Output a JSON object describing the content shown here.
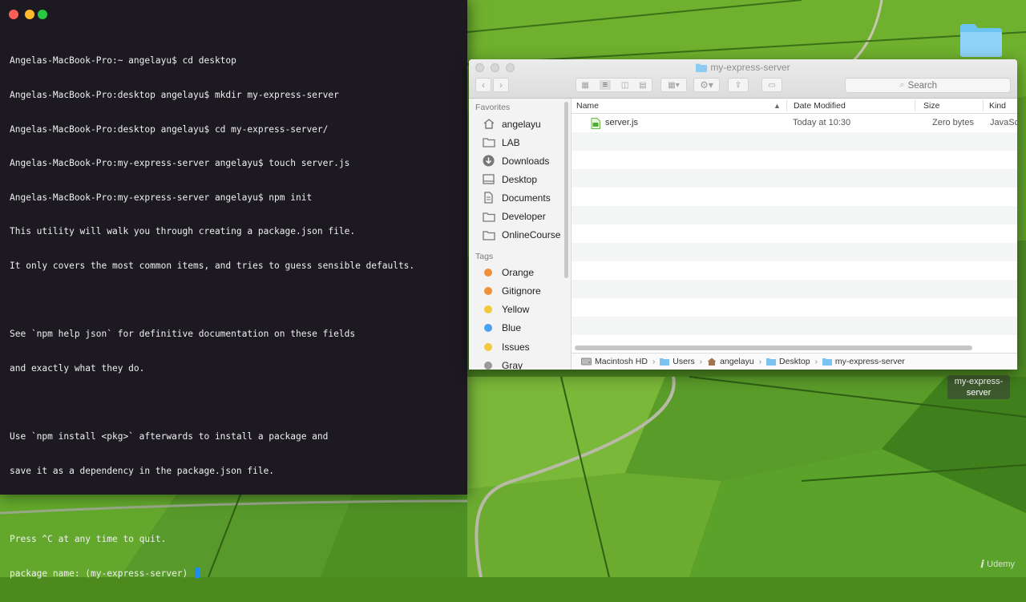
{
  "terminal": {
    "lines": [
      "Angelas-MacBook-Pro:~ angelayu$ cd desktop",
      "Angelas-MacBook-Pro:desktop angelayu$ mkdir my-express-server",
      "Angelas-MacBook-Pro:desktop angelayu$ cd my-express-server/",
      "Angelas-MacBook-Pro:my-express-server angelayu$ touch server.js",
      "Angelas-MacBook-Pro:my-express-server angelayu$ npm init",
      "This utility will walk you through creating a package.json file.",
      "It only covers the most common items, and tries to guess sensible defaults.",
      "",
      "See `npm help json` for definitive documentation on these fields",
      "and exactly what they do.",
      "",
      "Use `npm install <pkg>` afterwards to install a package and",
      "save it as a dependency in the package.json file.",
      "",
      "Press ^C at any time to quit.",
      "package name: (my-express-server) "
    ]
  },
  "finder": {
    "title": "my-express-server",
    "search_placeholder": "Search",
    "sidebar": {
      "favorites_heading": "Favorites",
      "favorites": [
        {
          "label": "angelayu",
          "icon": "home-icon"
        },
        {
          "label": "LAB",
          "icon": "folder-icon"
        },
        {
          "label": "Downloads",
          "icon": "downloads-icon"
        },
        {
          "label": "Desktop",
          "icon": "desktop-icon"
        },
        {
          "label": "Documents",
          "icon": "documents-icon"
        },
        {
          "label": "Developer",
          "icon": "folder-icon"
        },
        {
          "label": "OnlineCourse",
          "icon": "folder-icon"
        }
      ],
      "tags_heading": "Tags",
      "tags": [
        {
          "label": "Orange",
          "color": "#f0913a"
        },
        {
          "label": "Gitignore",
          "color": "#f0913a"
        },
        {
          "label": "Yellow",
          "color": "#f2c83c"
        },
        {
          "label": "Blue",
          "color": "#4aa1f0"
        },
        {
          "label": "Issues",
          "color": "#f2c83c"
        },
        {
          "label": "Gray",
          "color": "#9a9a9a"
        }
      ]
    },
    "columns": {
      "name": "Name",
      "date_modified": "Date Modified",
      "size": "Size",
      "kind": "Kind"
    },
    "files": [
      {
        "name": "server.js",
        "date_modified": "Today at 10:30",
        "size": "Zero bytes",
        "kind": "JavaSc"
      }
    ],
    "path": [
      "Macintosh HD",
      "Users",
      "angelayu",
      "Desktop",
      "my-express-server"
    ]
  },
  "desktop": {
    "folder_label": "my-express-server",
    "watermark": "Udemy"
  }
}
